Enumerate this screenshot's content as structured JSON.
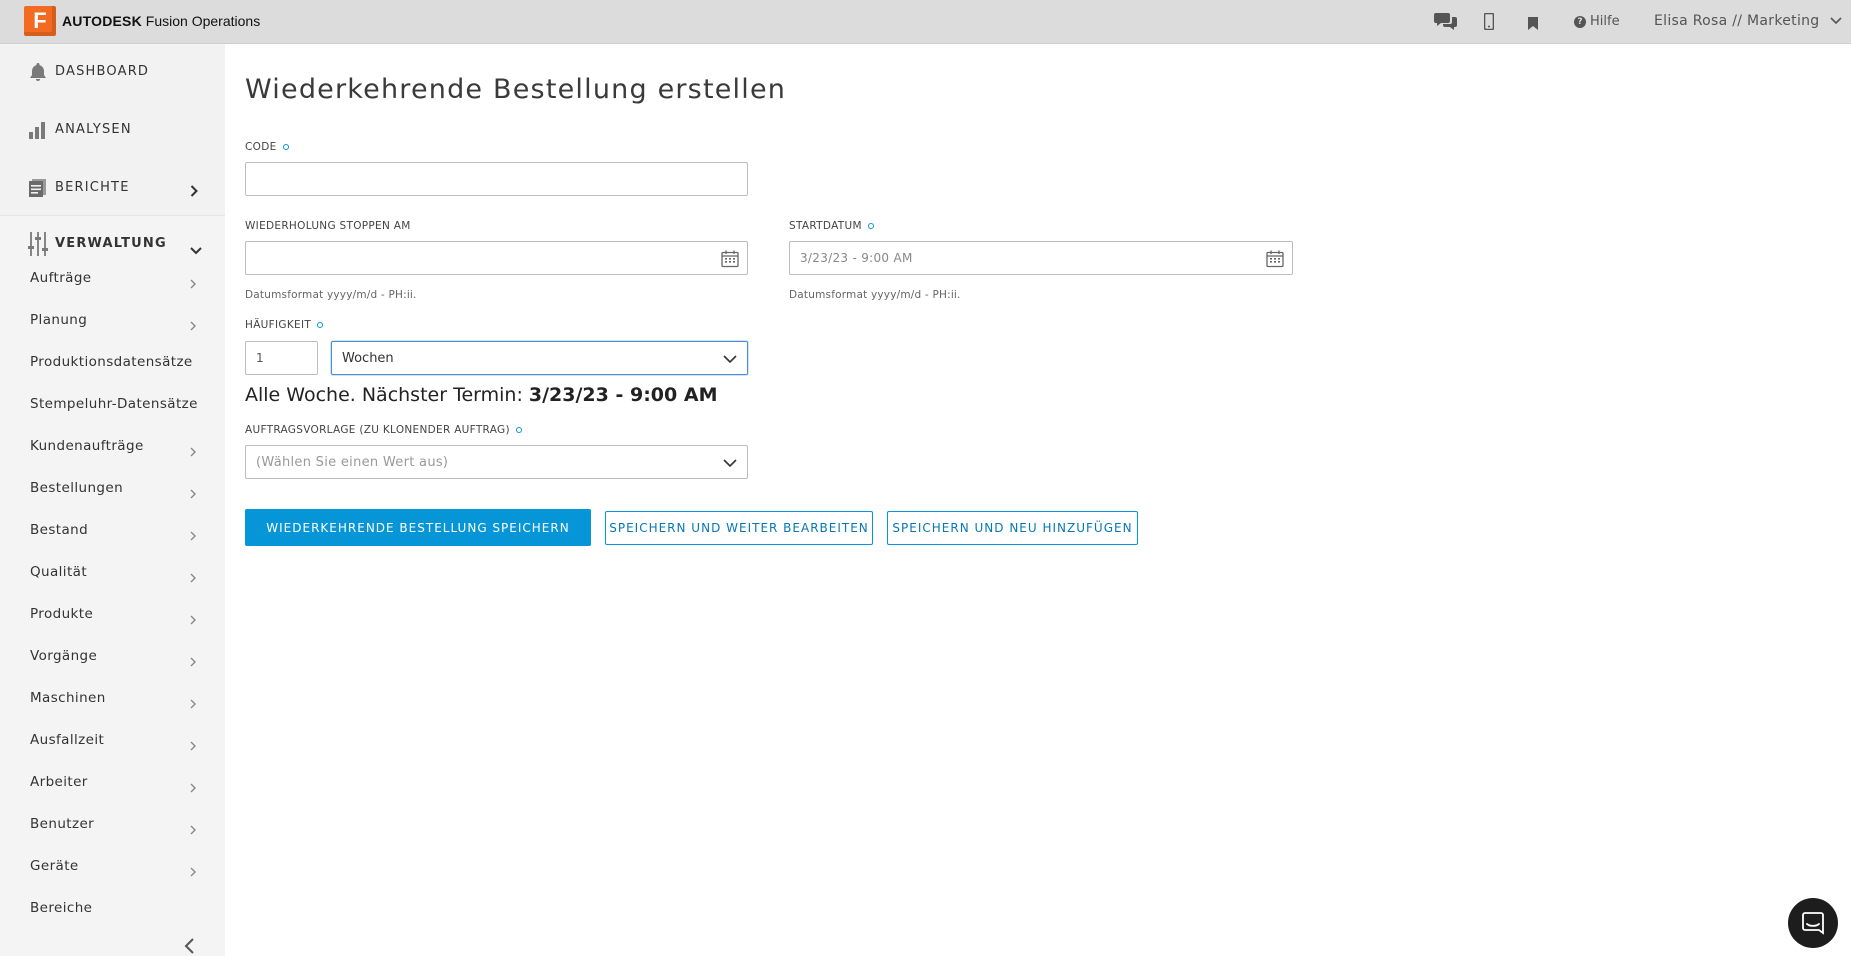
{
  "brand": {
    "logo_letter": "F",
    "name_bold": "AUTODESK",
    "name_rest": " Fusion Operations"
  },
  "topbar": {
    "icons": [
      "chat-icon",
      "mobile-icon",
      "bookmark-icon",
      "help-icon"
    ],
    "help_label": "Hilfe",
    "user_label": "Elisa Rosa // Marketing"
  },
  "sidebar": {
    "main_items": [
      {
        "label": "DASHBOARD",
        "icon": "bell-icon"
      },
      {
        "label": "ANALYSEN",
        "icon": "bar-chart-icon"
      },
      {
        "label": "BERICHTE",
        "icon": "report-icon"
      },
      {
        "label": "VERWALTUNG",
        "icon": "sliders-icon"
      }
    ],
    "sub_items": [
      {
        "label": "Aufträge",
        "has_arrow": true
      },
      {
        "label": "Planung",
        "has_arrow": true
      },
      {
        "label": "Produktionsdatensätze",
        "has_arrow": false
      },
      {
        "label": "Stempeluhr-Datensätze",
        "has_arrow": false
      },
      {
        "label": "Kundenaufträge",
        "has_arrow": true
      },
      {
        "label": "Bestellungen",
        "has_arrow": true
      },
      {
        "label": "Bestand",
        "has_arrow": true
      },
      {
        "label": "Qualität",
        "has_arrow": true
      },
      {
        "label": "Produkte",
        "has_arrow": true
      },
      {
        "label": "Vorgänge",
        "has_arrow": true
      },
      {
        "label": "Maschinen",
        "has_arrow": true
      },
      {
        "label": "Ausfallzeit",
        "has_arrow": true
      },
      {
        "label": "Arbeiter",
        "has_arrow": true
      },
      {
        "label": "Benutzer",
        "has_arrow": true
      },
      {
        "label": "Geräte",
        "has_arrow": true
      },
      {
        "label": "Bereiche",
        "has_arrow": false
      }
    ]
  },
  "form": {
    "title": "Wiederkehrende Bestellung erstellen",
    "code_label": "CODE",
    "code_value": "",
    "stop_label": "WIEDERHOLUNG STOPPEN AM",
    "stop_value": "",
    "stop_hint": "Datumsformat yyyy/m/d - PH:ii.",
    "start_label": "STARTDATUM",
    "start_placeholder": "3/23/23 - 9:00 AM",
    "start_hint": "Datumsformat yyyy/m/d - PH:ii.",
    "frequency_label": "HÄUFIGKEIT",
    "frequency_value": "1",
    "frequency_unit": "Wochen",
    "next_term_prefix": "Alle Woche. Nächster Termin: ",
    "next_term_value": "3/23/23 - 9:00 AM",
    "template_label": "AUFTRAGSVORLAGE (ZU KLONENDER AUFTRAG)",
    "template_placeholder": "(Wählen Sie einen Wert aus)"
  },
  "buttons": {
    "save": "WIEDERKEHRENDE BESTELLUNG SPEICHERN",
    "save_continue": "SPEICHERN UND WEITER BEARBEITEN",
    "save_new": "SPEICHERN UND NEU HINZUFÜGEN"
  },
  "colors": {
    "accent": "#0696d7",
    "brand": "#f36b21",
    "topbar": "#dcdcdc",
    "sidebar": "#f2f2f2"
  }
}
